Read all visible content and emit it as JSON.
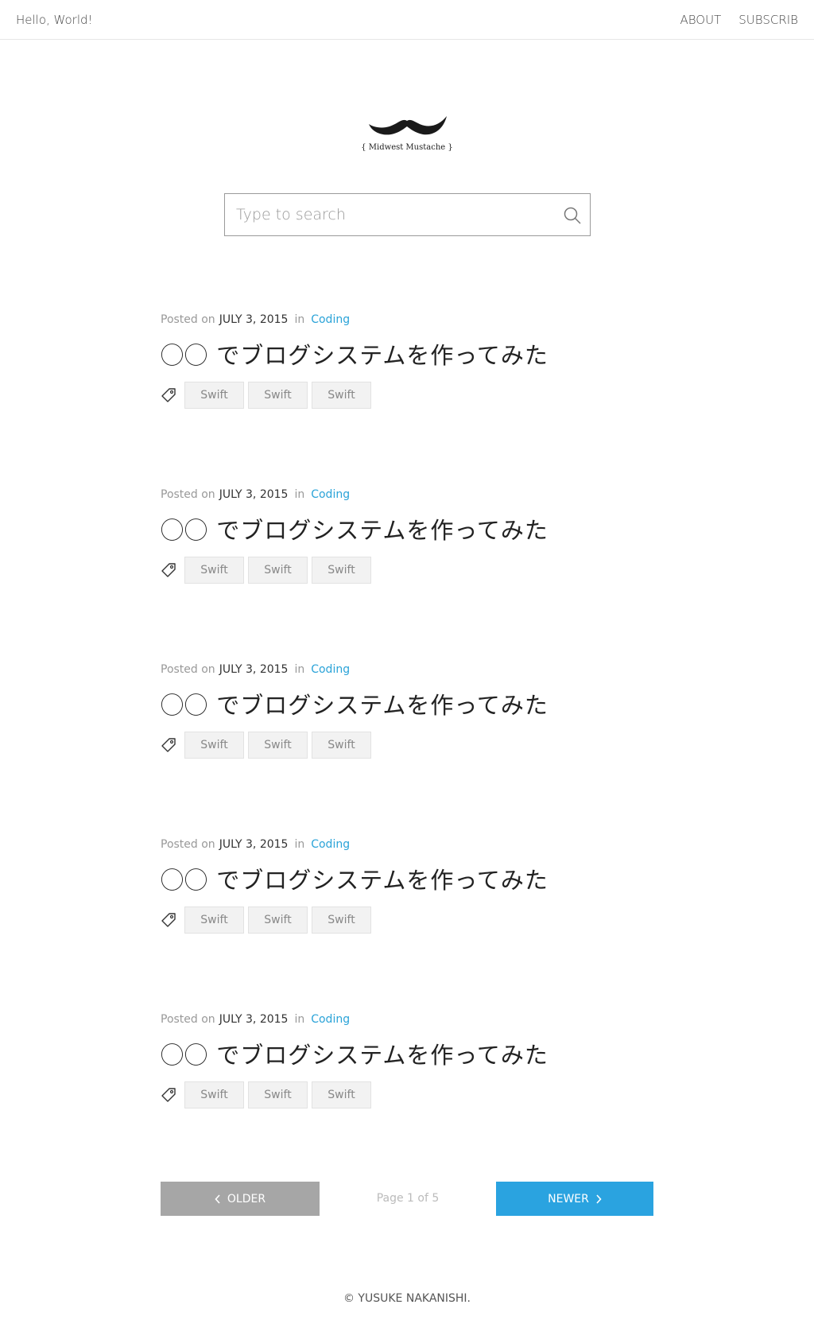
{
  "header": {
    "brand": "Hello, World!",
    "nav": [
      {
        "label": "ABOUT"
      },
      {
        "label": "SUBSCRIB"
      }
    ]
  },
  "logo": {
    "caption": "{ Midwest Mustache }"
  },
  "search": {
    "placeholder": "Type to search",
    "value": ""
  },
  "posts": [
    {
      "posted_on": "Posted on",
      "date": "JULY 3, 2015",
      "in": "in",
      "category": "Coding",
      "title": "◯◯ でブログシステムを作ってみた",
      "tags": [
        "Swift",
        "Swift",
        "Swift"
      ]
    },
    {
      "posted_on": "Posted on",
      "date": "JULY 3, 2015",
      "in": "in",
      "category": "Coding",
      "title": "◯◯ でブログシステムを作ってみた",
      "tags": [
        "Swift",
        "Swift",
        "Swift"
      ]
    },
    {
      "posted_on": "Posted on",
      "date": "JULY 3, 2015",
      "in": "in",
      "category": "Coding",
      "title": "◯◯ でブログシステムを作ってみた",
      "tags": [
        "Swift",
        "Swift",
        "Swift"
      ]
    },
    {
      "posted_on": "Posted on",
      "date": "JULY 3, 2015",
      "in": "in",
      "category": "Coding",
      "title": "◯◯ でブログシステムを作ってみた",
      "tags": [
        "Swift",
        "Swift",
        "Swift"
      ]
    },
    {
      "posted_on": "Posted on",
      "date": "JULY 3, 2015",
      "in": "in",
      "category": "Coding",
      "title": "◯◯ でブログシステムを作ってみた",
      "tags": [
        "Swift",
        "Swift",
        "Swift"
      ]
    }
  ],
  "pagination": {
    "older_label": "OLDER",
    "page_info": "Page 1 of 5",
    "newer_label": "NEWER"
  },
  "footer": {
    "copyright": "© YUSUKE NAKANISHI."
  },
  "colors": {
    "accent": "#2aa3e0",
    "category": "#2aa3d8",
    "older_button": "#a6a6a6"
  }
}
